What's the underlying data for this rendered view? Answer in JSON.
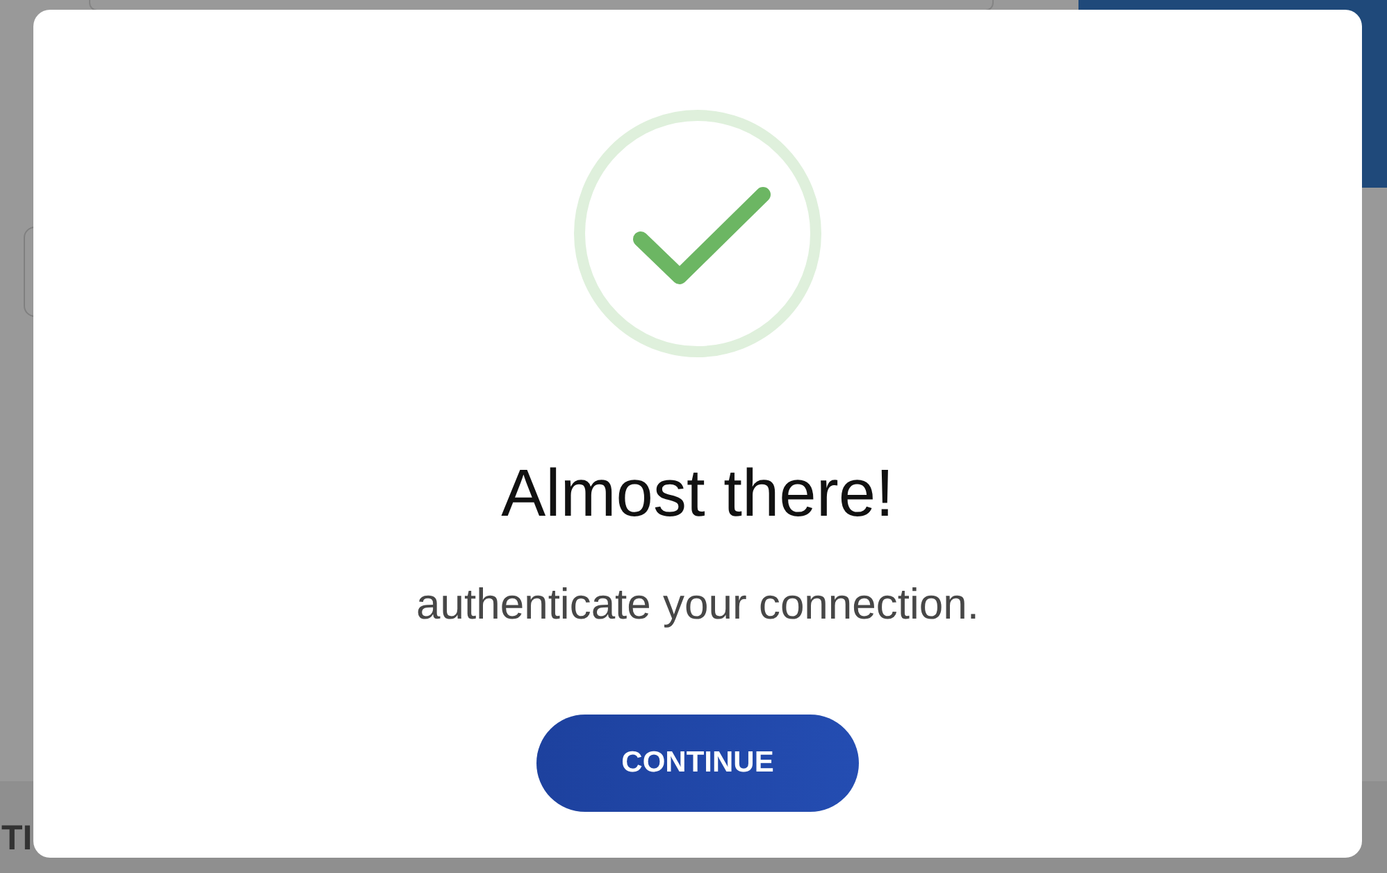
{
  "background_page": {
    "footer_heading": "TI"
  },
  "dialog": {
    "title": "Almost there!",
    "message": "authenticate your connection.",
    "button": "CONTINUE"
  }
}
